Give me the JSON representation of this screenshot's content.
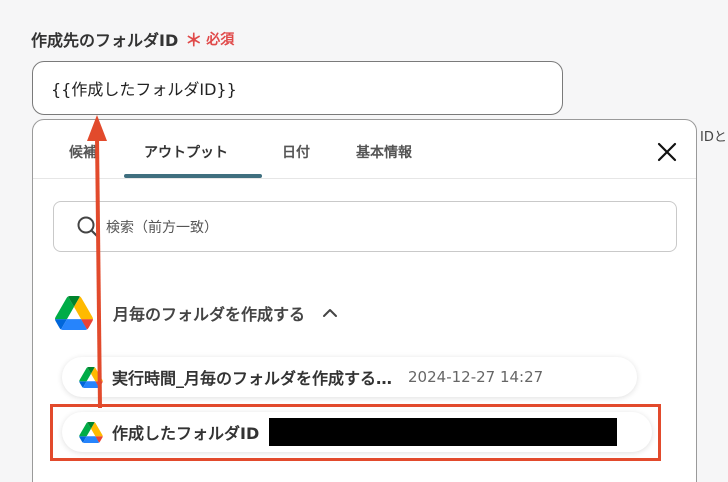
{
  "field": {
    "label": "作成先のフォルダID",
    "required_mark": "＊",
    "required_text": "必須",
    "value": "{{作成したフォルダID}}"
  },
  "background_peek": "IDと",
  "tabs": [
    {
      "label": "候補",
      "active": false
    },
    {
      "label": "アウトプット",
      "active": true
    },
    {
      "label": "日付",
      "active": false
    },
    {
      "label": "基本情報",
      "active": false
    }
  ],
  "search": {
    "placeholder": "検索（前方一致）"
  },
  "group": {
    "icon": "google-drive-icon",
    "title": "月毎のフォルダを作成する",
    "expanded": true
  },
  "items": [
    {
      "label": "実行時間_月毎のフォルダを作成する…",
      "value": "2024-12-27 14:27"
    },
    {
      "label": "作成したフォルダID",
      "value_redacted": true
    }
  ],
  "colors": {
    "accent": "#3f6f7f",
    "required": "#e04a4a",
    "annotation": "#e24a2c"
  }
}
